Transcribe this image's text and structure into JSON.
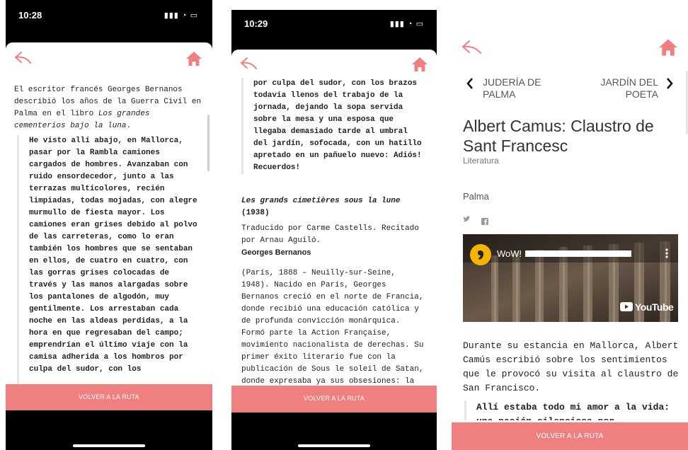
{
  "colors": {
    "accent": "#f08080",
    "text": "#222222",
    "muted": "#888888"
  },
  "screen1": {
    "status_time": "10:28",
    "status_icons": "▮▮▮ ◔ ▭",
    "back_icon": "reply-arrow-icon",
    "home_icon": "home-icon",
    "intro_a": "El escritor francés Georges Bernanos describió los años de la Guerra Civil en Palma en el libro ",
    "intro_italic": "Los grandes cementerios bajo la luna",
    "intro_end": ".",
    "quote": "He visto allí abajo, en Mallorca, pasar por la Rambla camiones cargados de hombres. Avanzaban con ruido ensordecedor, junto a las terrazas multicolores, recién limpiadas, todas mojadas, con alegre murmullo de fiesta mayor. Los camiones eran grises debido al polvo de las carreteras, como lo eran también los hombres que se sentaban en ellos, de cuatro en cuatro, con las gorras grises colocadas de través y las manos alargadas sobre los pantalones de algodón, muy gentilmente. Los arrestaban cada noche en las aldeas perdidas, a la hora en que regresaban del campo; emprendrían el último viaje con la camisa adherida a los hombros por culpa del sudor, con los",
    "button": "VOLVER A LA RUTA"
  },
  "screen2": {
    "status_time": "10:29",
    "status_icons": "▮▮▮ ◔ ▭",
    "quote_cont": "por culpa del sudor, con los brazos todavía llenos del trabajo de la jornada, dejando la sopa servida sobre la mesa y una esposa que llegaba demasiado tarde al umbral del jardín, sofocada, con un hatillo apretado en un pañuelo nuevo: Adiós! Recuerdos!",
    "book_title": "Les grands cimetières sous la lune",
    "book_year": "(1938)",
    "credits": "Traducido por Carme Castells. Recitado por Arnau Aguiló.",
    "author": "Georges Bernanos",
    "bio": "(París, 1888 – Neuilly-sur-Seine, 1948). Nacido en París, Georges Bernanos creció en el norte de Francia, donde recibió una educación católica y de profunda convicción monárquica. Formó parte la Action Française, movimiento nacionalista de derechas. Su primer éxito literario fue con la publicación de Sous le soleil de Satan, donde expresaba ya sus obsesiones: la",
    "button": "VOLVER A LA RUTA"
  },
  "screen3": {
    "prev_label_1": "JUDERÍA DE",
    "prev_label_2": "PALMA",
    "next_label_1": "JARDÍN DEL",
    "next_label_2": "POETA",
    "title": "Albert Camus: Claustro de Sant Francesc",
    "category": "Literatura",
    "location": "Palma",
    "video_channel": "WoW!",
    "video_brand": "YouTube",
    "body": "Durante su estancia en Mallorca, Albert Camús escribió sobre los sentimientos que le provocó su visita al claustro de San Francisco.",
    "quote": "Allí estaba todo mi amor a la vida: una pasión silenciosa por",
    "button": "VOLVER A LA RUTA"
  }
}
